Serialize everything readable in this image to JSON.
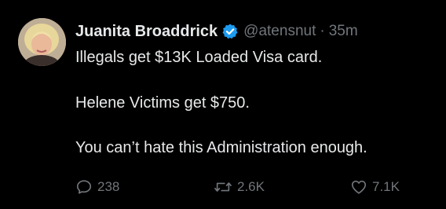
{
  "tweet": {
    "author": {
      "display_name": "Juanita Broaddrick",
      "handle": "@atensnut",
      "separator": "·",
      "time": "35m",
      "verified_icon": "verified-badge-icon",
      "verified_color": "#1d9bf0"
    },
    "body": {
      "line1": "Illegals get $13K Loaded Visa card.",
      "line2": "Helene Victims get $750.",
      "line3": "You can’t hate this Administration enough."
    },
    "actions": {
      "replies": "238",
      "reposts": "2.6K",
      "likes": "7.1K"
    }
  },
  "colors": {
    "background": "#000000",
    "primary_text": "#e7e9ea",
    "secondary_text": "#71767b"
  }
}
